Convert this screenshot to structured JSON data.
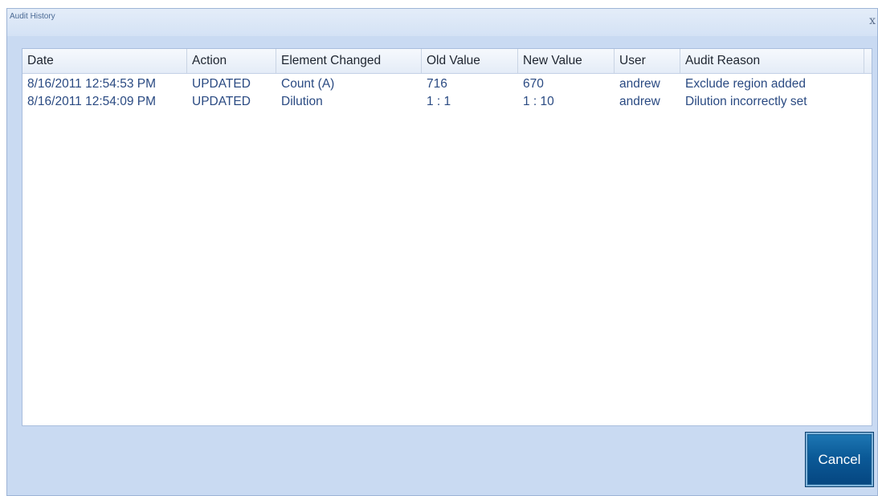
{
  "window": {
    "title": "Audit History",
    "close_glyph": "x"
  },
  "table": {
    "columns": [
      "Date",
      "Action",
      "Element Changed",
      "Old Value",
      "New Value",
      "User",
      "Audit Reason"
    ],
    "rows": [
      {
        "date": "8/16/2011 12:54:53 PM",
        "action": "UPDATED",
        "element": "Count (A)",
        "old": "716",
        "new": "670",
        "user": "andrew",
        "reason": "Exclude region added"
      },
      {
        "date": "8/16/2011 12:54:09 PM",
        "action": "UPDATED",
        "element": "Dilution",
        "old": "1 : 1",
        "new": "1 : 10",
        "user": "andrew",
        "reason": "Dilution incorrectly set"
      }
    ]
  },
  "buttons": {
    "cancel_label": "Cancel"
  },
  "colors": {
    "row_text": "#2a4a82",
    "dialog_bg": "#c9daf2",
    "button_blue": "#0b5a98"
  },
  "icons": {
    "close": "close-icon"
  }
}
